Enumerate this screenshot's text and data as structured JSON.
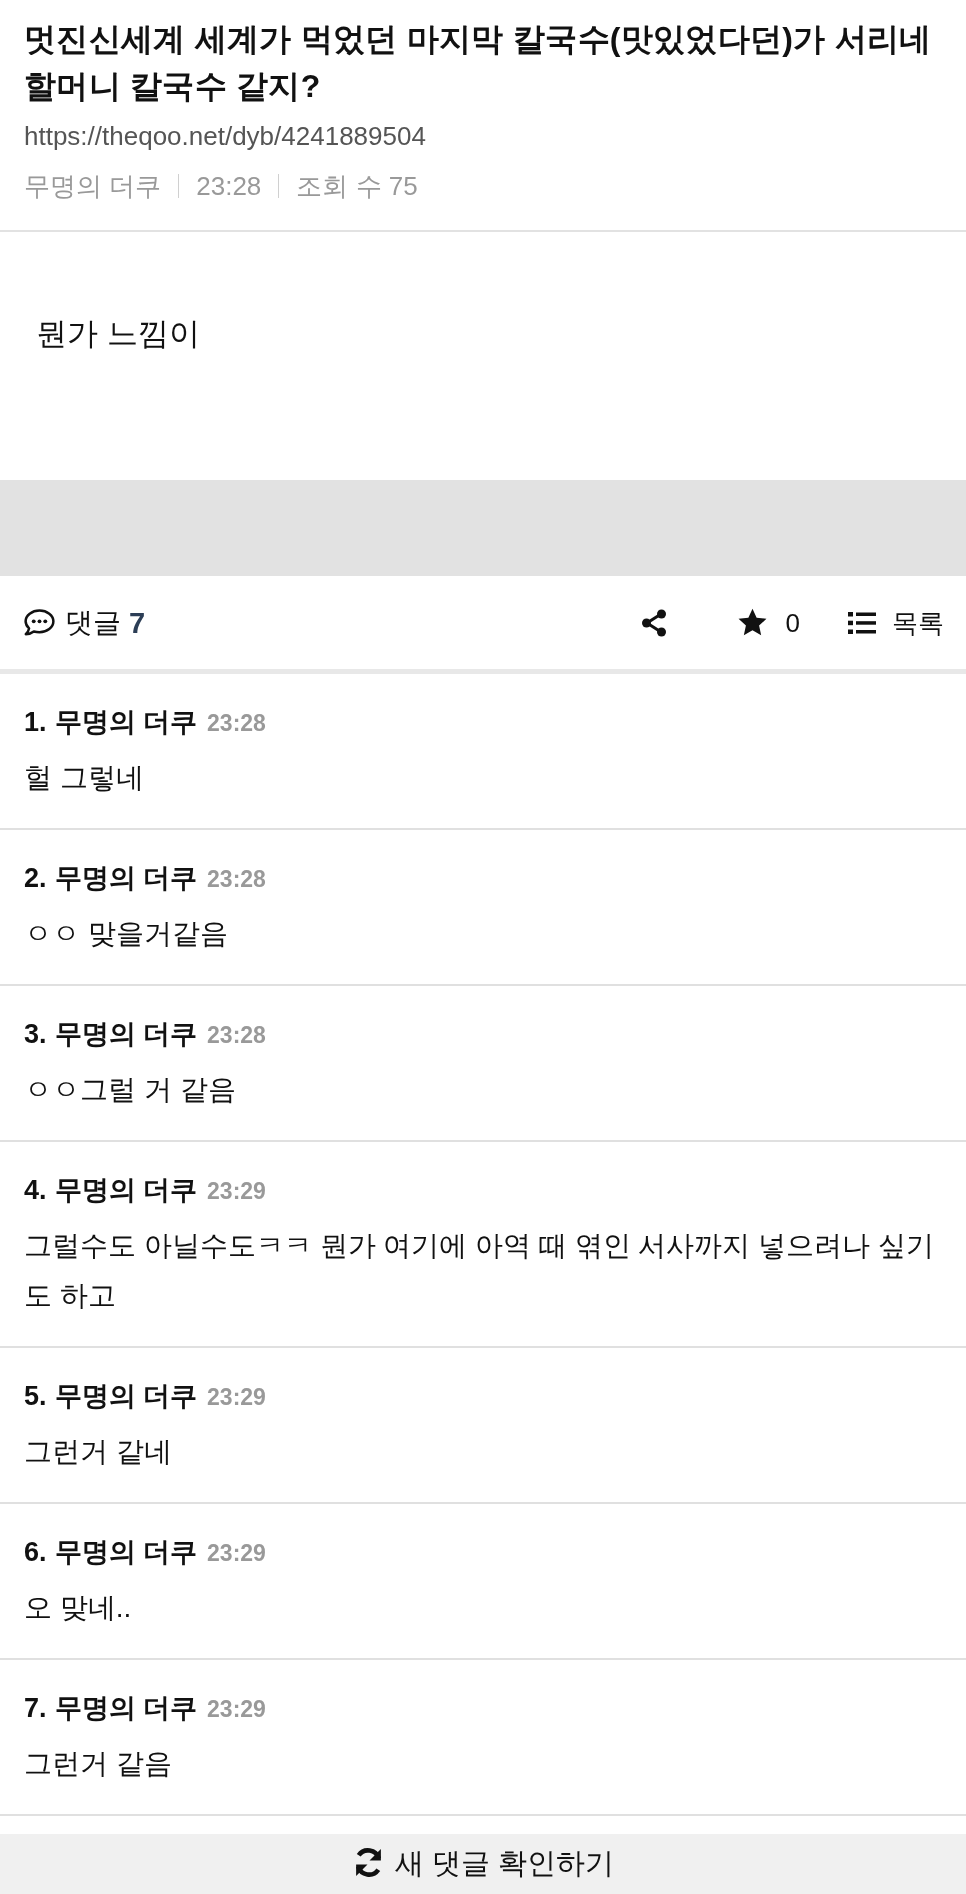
{
  "post": {
    "title": "멋진신세계 세계가 먹었던 마지막 칼국수(맛있었다던)가 서리네 할머니 칼국수 같지?",
    "url": "https://theqoo.net/dyb/4241889504",
    "meta": {
      "author": "무명의 더쿠",
      "time": "23:28",
      "views": "조회 수 75"
    },
    "body": "뭔가 느낌이"
  },
  "toolbar": {
    "comments_label": "댓글",
    "comments_count": "7",
    "favorite_count": "0",
    "list_label": "목록"
  },
  "comments": [
    {
      "number": "1.",
      "author": "무명의 더쿠",
      "time": "23:28",
      "text": "헐 그렇네"
    },
    {
      "number": "2.",
      "author": "무명의 더쿠",
      "time": "23:28",
      "text": "ㅇㅇ 맞을거같음"
    },
    {
      "number": "3.",
      "author": "무명의 더쿠",
      "time": "23:28",
      "text": "ㅇㅇ그럴 거 같음"
    },
    {
      "number": "4.",
      "author": "무명의 더쿠",
      "time": "23:29",
      "text": "그럴수도 아닐수도ㅋㅋ 뭔가 여기에 아역 때 엮인 서사까지 넣으려나 싶기도 하고"
    },
    {
      "number": "5.",
      "author": "무명의 더쿠",
      "time": "23:29",
      "text": "그런거 같네"
    },
    {
      "number": "6.",
      "author": "무명의 더쿠",
      "time": "23:29",
      "text": "오 맞네.."
    },
    {
      "number": "7.",
      "author": "무명의 더쿠",
      "time": "23:29",
      "text": "그런거 같음"
    }
  ],
  "refresh_button": {
    "label": "새 댓글 확인하기"
  }
}
